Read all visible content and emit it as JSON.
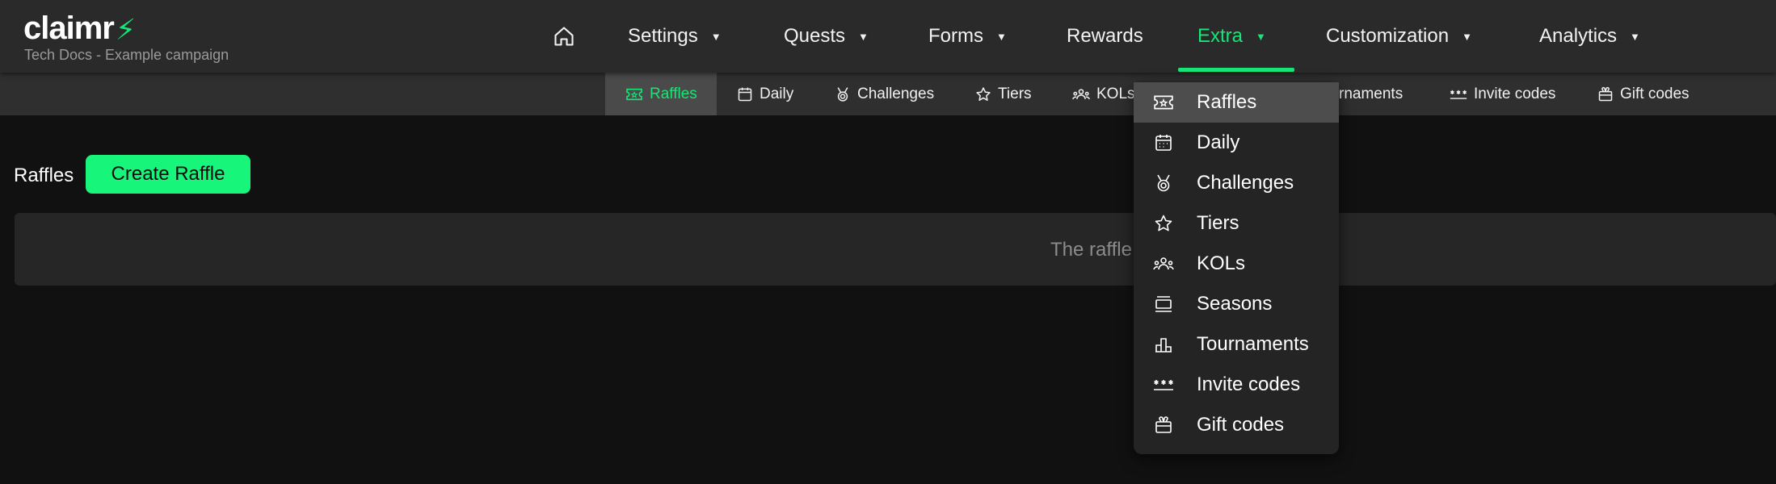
{
  "brand": {
    "name": "claimr",
    "subtitle": "Tech Docs - Example campaign",
    "accent": "#17e677"
  },
  "nav": {
    "home_icon": "home-icon",
    "items": [
      {
        "label": "Settings",
        "has_caret": true
      },
      {
        "label": "Quests",
        "has_caret": true
      },
      {
        "label": "Forms",
        "has_caret": true
      },
      {
        "label": "Rewards",
        "has_caret": false
      },
      {
        "label": "Extra",
        "has_caret": true,
        "active": true
      },
      {
        "label": "Customization",
        "has_caret": true
      },
      {
        "label": "Analytics",
        "has_caret": true
      }
    ]
  },
  "subnav": {
    "items": [
      {
        "label": "Raffles",
        "icon": "ticket-icon",
        "active": true
      },
      {
        "label": "Daily",
        "icon": "calendar-icon"
      },
      {
        "label": "Challenges",
        "icon": "medal-icon"
      },
      {
        "label": "Tiers",
        "icon": "star-icon"
      },
      {
        "label": "KOLs",
        "icon": "people-icon"
      },
      {
        "label": "rnaments",
        "icon": "podium-icon"
      },
      {
        "label": "Invite codes",
        "icon": "asterisks-icon"
      },
      {
        "label": "Gift codes",
        "icon": "gift-icon"
      }
    ]
  },
  "main": {
    "heading": "Raffles",
    "create_button": "Create Raffle",
    "empty_text": "The raffle"
  },
  "dropdown": {
    "items": [
      {
        "label": "Raffles",
        "icon": "ticket-icon",
        "active": true
      },
      {
        "label": "Daily",
        "icon": "calendar-icon"
      },
      {
        "label": "Challenges",
        "icon": "medal-icon"
      },
      {
        "label": "Tiers",
        "icon": "star-icon"
      },
      {
        "label": "KOLs",
        "icon": "people-icon"
      },
      {
        "label": "Seasons",
        "icon": "seasons-icon"
      },
      {
        "label": "Tournaments",
        "icon": "podium-icon"
      },
      {
        "label": "Invite codes",
        "icon": "asterisks-icon"
      },
      {
        "label": "Gift codes",
        "icon": "gift-icon"
      }
    ]
  }
}
